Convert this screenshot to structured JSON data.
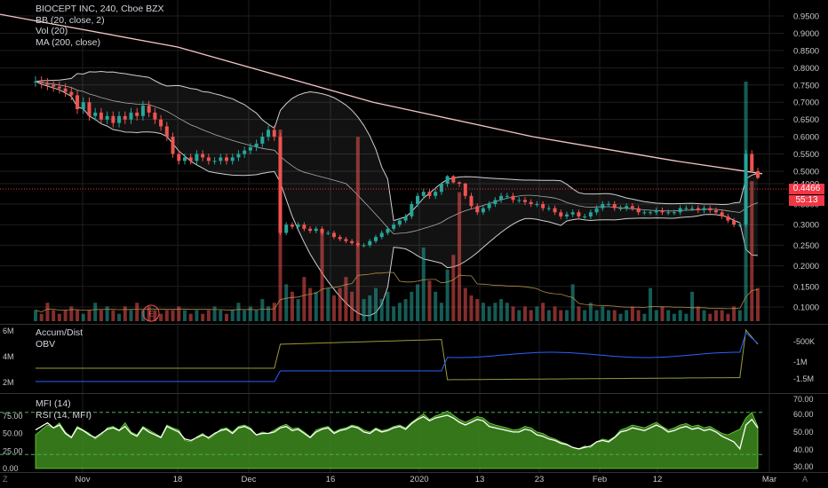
{
  "legend": {
    "title": "BIOCEPT INC, 240, Cboe BZX",
    "bb": "BB (20, close, 2)",
    "vol": "Vol (20)",
    "ma": "MA (200, close)",
    "accum": "Accum/Dist",
    "obv": "OBV",
    "mfi": "MFI (14)",
    "rsi": "RSI (14, MFI)"
  },
  "price_tag": {
    "price": "0.4466",
    "countdown": "55:13"
  },
  "earnings_marker": "E",
  "corner_left": "Z",
  "corner_right": "A",
  "colors": {
    "up": "#26a69a",
    "down": "#ef5350",
    "ma": "#f3c6c6",
    "bb": "#cfcfcf",
    "accum": "#9c9a3a",
    "obv": "#2962ff",
    "mfi_fill": "#3f8b1f",
    "rsi": "#ffffff",
    "tag": "#f23645"
  },
  "chart_data": {
    "type": "candlestick",
    "symbol": "BIOCEPT INC",
    "interval": "240",
    "exchange": "Cboe BZX",
    "last_price": 0.4466,
    "price_axis": {
      "ticks": [
        "0.9500",
        "0.9000",
        "0.8500",
        "0.8000",
        "0.7500",
        "0.7000",
        "0.6500",
        "0.6000",
        "0.5500",
        "0.5000",
        "0.4000",
        "0.3500",
        "0.3000",
        "0.2500",
        "0.2000",
        "0.1500",
        "0.1000"
      ],
      "ylim": [
        0.06,
        0.97
      ]
    },
    "time_axis": [
      "Nov",
      "18",
      "Dec",
      "16",
      "2020",
      "13",
      "23",
      "Feb",
      "12",
      "Mar"
    ],
    "closes": [
      0.76,
      0.755,
      0.75,
      0.745,
      0.74,
      0.73,
      0.72,
      0.68,
      0.7,
      0.66,
      0.67,
      0.65,
      0.66,
      0.64,
      0.66,
      0.65,
      0.67,
      0.66,
      0.69,
      0.67,
      0.65,
      0.63,
      0.6,
      0.55,
      0.53,
      0.54,
      0.53,
      0.55,
      0.54,
      0.53,
      0.53,
      0.54,
      0.53,
      0.54,
      0.55,
      0.56,
      0.57,
      0.58,
      0.6,
      0.62,
      0.6,
      0.28,
      0.3,
      0.295,
      0.3,
      0.29,
      0.285,
      0.29,
      0.28,
      0.28,
      0.27,
      0.265,
      0.26,
      0.255,
      0.25,
      0.25,
      0.26,
      0.27,
      0.28,
      0.29,
      0.3,
      0.31,
      0.32,
      0.35,
      0.37,
      0.38,
      0.37,
      0.38,
      0.4,
      0.46,
      0.41,
      0.4,
      0.37,
      0.345,
      0.33,
      0.34,
      0.35,
      0.36,
      0.37,
      0.37,
      0.36,
      0.36,
      0.355,
      0.35,
      0.35,
      0.34,
      0.34,
      0.33,
      0.32,
      0.325,
      0.33,
      0.32,
      0.32,
      0.33,
      0.34,
      0.35,
      0.35,
      0.34,
      0.34,
      0.345,
      0.34,
      0.33,
      0.33,
      0.33,
      0.335,
      0.33,
      0.33,
      0.33,
      0.34,
      0.34,
      0.34,
      0.335,
      0.34,
      0.335,
      0.33,
      0.32,
      0.31,
      0.3,
      0.3,
      0.55,
      0.5,
      0.4466
    ],
    "ma200": [
      [
        0,
        0.955
      ],
      [
        200,
        0.86
      ],
      [
        420,
        0.7
      ],
      [
        600,
        0.6
      ],
      [
        760,
        0.53
      ],
      [
        858,
        0.48
      ]
    ],
    "volume": [
      0.3,
      0.2,
      0.5,
      0.3,
      0.2,
      0.3,
      0.4,
      0.3,
      0.2,
      0.3,
      0.5,
      0.3,
      0.4,
      0.3,
      0.2,
      0.4,
      0.3,
      0.5,
      0.3,
      0.4,
      0.3,
      0.2,
      0.3,
      0.3,
      0.4,
      0.3,
      0.2,
      0.3,
      0.2,
      0.3,
      0.4,
      0.3,
      0.2,
      0.3,
      0.5,
      0.3,
      0.4,
      0.3,
      0.6,
      0.4,
      0.5,
      5.2,
      1.0,
      0.8,
      0.6,
      1.2,
      0.9,
      0.8,
      2.4,
      0.9,
      0.7,
      0.9,
      1.2,
      0.8,
      5.0,
      0.6,
      0.7,
      0.9,
      0.6,
      0.8,
      0.4,
      0.5,
      0.6,
      0.8,
      1.0,
      2.0,
      1.1,
      0.8,
      0.5,
      1.4,
      1.8,
      3.5,
      0.9,
      0.7,
      0.6,
      0.5,
      0.4,
      0.5,
      0.6,
      0.5,
      0.4,
      0.3,
      0.4,
      0.3,
      0.4,
      0.5,
      0.3,
      0.4,
      0.3,
      0.3,
      1.0,
      0.4,
      0.3,
      0.5,
      0.3,
      0.4,
      0.3,
      0.3,
      0.2,
      0.3,
      0.4,
      0.3,
      0.2,
      0.9,
      0.3,
      0.4,
      0.3,
      0.2,
      0.3,
      0.2,
      0.8,
      0.4,
      0.3,
      0.2,
      0.3,
      0.3,
      0.2,
      0.4,
      0.3,
      6.5,
      3.8,
      0.9
    ],
    "oscillator_axes": {
      "obv_left": [
        "6M",
        "4M",
        "2M"
      ],
      "obv_right": [
        "-500K",
        "-1M",
        "-1.5M"
      ],
      "mfi_left": [
        "75.00",
        "50.00",
        "25.00",
        "0.00"
      ],
      "rsi_right": [
        "70.00",
        "60.00",
        "50.00",
        "40.00",
        "30.00"
      ]
    },
    "mfi": [
      48,
      55,
      62,
      58,
      65,
      52,
      45,
      60,
      55,
      50,
      42,
      48,
      58,
      60,
      55,
      65,
      52,
      48,
      60,
      55,
      50,
      45,
      62,
      58,
      55,
      40,
      38,
      45,
      50,
      42,
      48,
      56,
      58,
      52,
      60,
      62,
      58,
      48,
      52,
      50,
      55,
      60,
      63,
      57,
      58,
      52,
      45,
      55,
      58,
      60,
      52,
      56,
      58,
      62,
      60,
      55,
      52,
      58,
      54,
      56,
      60,
      62,
      58,
      66,
      72,
      78,
      70,
      75,
      78,
      82,
      76,
      70,
      66,
      70,
      74,
      72,
      65,
      62,
      60,
      58,
      55,
      56,
      60,
      58,
      52,
      50,
      45,
      42,
      38,
      35,
      30,
      28,
      32,
      30,
      38,
      42,
      40,
      45,
      55,
      58,
      62,
      60,
      58,
      62,
      66,
      60,
      55,
      58,
      62,
      64,
      60,
      62,
      58,
      60,
      55,
      50,
      48,
      52,
      56,
      72,
      80,
      60
    ],
    "rsi_mfi": [
      55,
      60,
      65,
      58,
      62,
      50,
      44,
      58,
      54,
      48,
      44,
      50,
      56,
      58,
      54,
      60,
      50,
      46,
      58,
      52,
      48,
      44,
      60,
      56,
      52,
      42,
      40,
      44,
      48,
      44,
      50,
      54,
      56,
      50,
      58,
      60,
      56,
      48,
      50,
      50,
      52,
      58,
      60,
      54,
      56,
      50,
      44,
      52,
      56,
      58,
      50,
      54,
      56,
      60,
      58,
      52,
      50,
      56,
      52,
      54,
      58,
      60,
      56,
      64,
      70,
      74,
      68,
      72,
      74,
      76,
      72,
      66,
      62,
      66,
      70,
      68,
      60,
      58,
      56,
      54,
      52,
      52,
      56,
      54,
      48,
      46,
      42,
      40,
      36,
      34,
      30,
      28,
      30,
      32,
      38,
      40,
      38,
      44,
      52,
      54,
      58,
      56,
      54,
      58,
      62,
      58,
      52,
      54,
      58,
      60,
      56,
      58,
      54,
      56,
      52,
      46,
      42,
      38,
      28,
      62,
      70,
      58
    ]
  }
}
